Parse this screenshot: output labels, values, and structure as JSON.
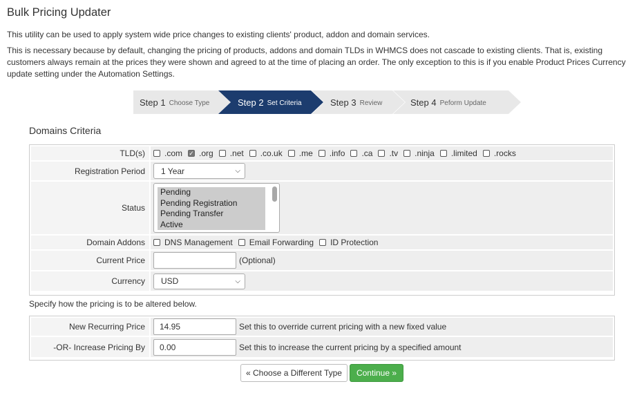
{
  "page": {
    "title": "Bulk Pricing Updater",
    "para1": "This utility can be used to apply system wide price changes to existing clients' product, addon and domain services.",
    "para2": "This is necessary because by default, changing the pricing of products, addons and domain TLDs in WHMCS does not cascade to existing clients. That is, existing customers always remain at the prices they were shown and agreed to at the time of placing an order. The only exception to this is if you enable Product Prices Currency update setting under the Automation Settings."
  },
  "steps": [
    {
      "label": "Step 1",
      "sub": "Choose Type"
    },
    {
      "label": "Step 2",
      "sub": "Set Criteria"
    },
    {
      "label": "Step 3",
      "sub": "Review"
    },
    {
      "label": "Step 4",
      "sub": "Peform Update"
    }
  ],
  "criteria": {
    "section_title": "Domains Criteria",
    "tld_label": "TLD(s)",
    "tlds": [
      {
        "name": ".com",
        "checked": false
      },
      {
        "name": ".org",
        "checked": true
      },
      {
        "name": ".net",
        "checked": false
      },
      {
        "name": ".co.uk",
        "checked": false
      },
      {
        "name": ".me",
        "checked": false
      },
      {
        "name": ".info",
        "checked": false
      },
      {
        "name": ".ca",
        "checked": false
      },
      {
        "name": ".tv",
        "checked": false
      },
      {
        "name": ".ninja",
        "checked": false
      },
      {
        "name": ".limited",
        "checked": false
      },
      {
        "name": ".rocks",
        "checked": false
      }
    ],
    "period_label": "Registration Period",
    "period_value": "1 Year",
    "status_label": "Status",
    "status_options": [
      "Pending",
      "Pending Registration",
      "Pending Transfer",
      "Active"
    ],
    "addons_label": "Domain Addons",
    "addons": [
      {
        "name": "DNS Management",
        "checked": false
      },
      {
        "name": "Email Forwarding",
        "checked": false
      },
      {
        "name": "ID Protection",
        "checked": false
      }
    ],
    "current_price_label": "Current Price",
    "current_price_value": "",
    "current_price_hint": "(Optional)",
    "currency_label": "Currency",
    "currency_value": "USD"
  },
  "alter": {
    "intro": "Specify how the pricing is to be altered below.",
    "new_price_label": "New Recurring Price",
    "new_price_value": "14.95",
    "new_price_hint": "Set this to override current pricing with a new fixed value",
    "increase_label": "-OR- Increase Pricing By",
    "increase_value": "0.00",
    "increase_hint": "Set this to increase the current pricing by a specified amount"
  },
  "buttons": {
    "back": "« Choose a Different Type",
    "continue": "Continue »"
  },
  "colors": {
    "active_step": "#1c3c6e",
    "continue_button": "#4cae4c"
  }
}
